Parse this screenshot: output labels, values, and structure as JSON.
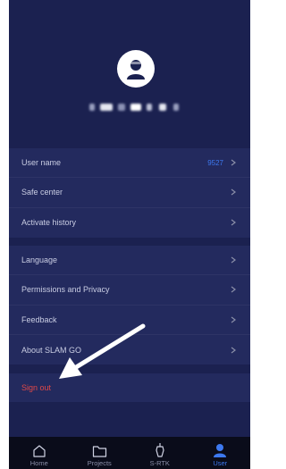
{
  "profile": {
    "avatar_icon": "user-avatar-icon",
    "username_obscured": true
  },
  "settings": {
    "group1": [
      {
        "label": "User name",
        "value": "9527"
      },
      {
        "label": "Safe center",
        "value": ""
      },
      {
        "label": "Activate history",
        "value": ""
      }
    ],
    "group2": [
      {
        "label": "Language"
      },
      {
        "label": "Permissions and Privacy"
      },
      {
        "label": "Feedback"
      },
      {
        "label": "About SLAM GO"
      }
    ],
    "sign_out": "Sign out"
  },
  "nav": {
    "items": [
      {
        "label": "Home",
        "icon": "home-icon"
      },
      {
        "label": "Projects",
        "icon": "folder-icon"
      },
      {
        "label": "S-RTK",
        "icon": "rtk-device-icon"
      },
      {
        "label": "User",
        "icon": "user-icon"
      }
    ],
    "active_index": 3
  },
  "colors": {
    "background": "#1b2150",
    "group_bg": "#232a5e",
    "accent": "#3d79f0",
    "danger": "#e04848",
    "nav_bg": "#0a0c1a"
  }
}
